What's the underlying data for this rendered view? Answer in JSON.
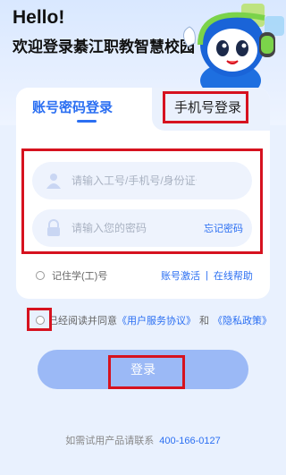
{
  "header": {
    "greeting": "Hello!",
    "welcome": "欢迎登录綦江职教智慧校园"
  },
  "tabs": {
    "account_login": "账号密码登录",
    "phone_login": "手机号登录"
  },
  "form": {
    "username_placeholder": "请输入工号/手机号/身份证号",
    "password_placeholder": "请输入您的密码",
    "forgot_password": "忘记密码",
    "remember_label": "记住学(工)号",
    "activate_account": "账号激活",
    "separator": "|",
    "online_help": "在线帮助"
  },
  "agreement": {
    "prefix": "已经阅读并同意",
    "user_agreement": "《用户服务协议》",
    "and": "和",
    "privacy_policy": "《隐私政策》"
  },
  "login_button": "登录",
  "footer": {
    "contact_text": "如需试用产品请联系",
    "phone": "400-166-0127"
  },
  "colors": {
    "accent": "#2b6ff2",
    "button": "#9bb9f6",
    "highlight": "#d6121f"
  }
}
